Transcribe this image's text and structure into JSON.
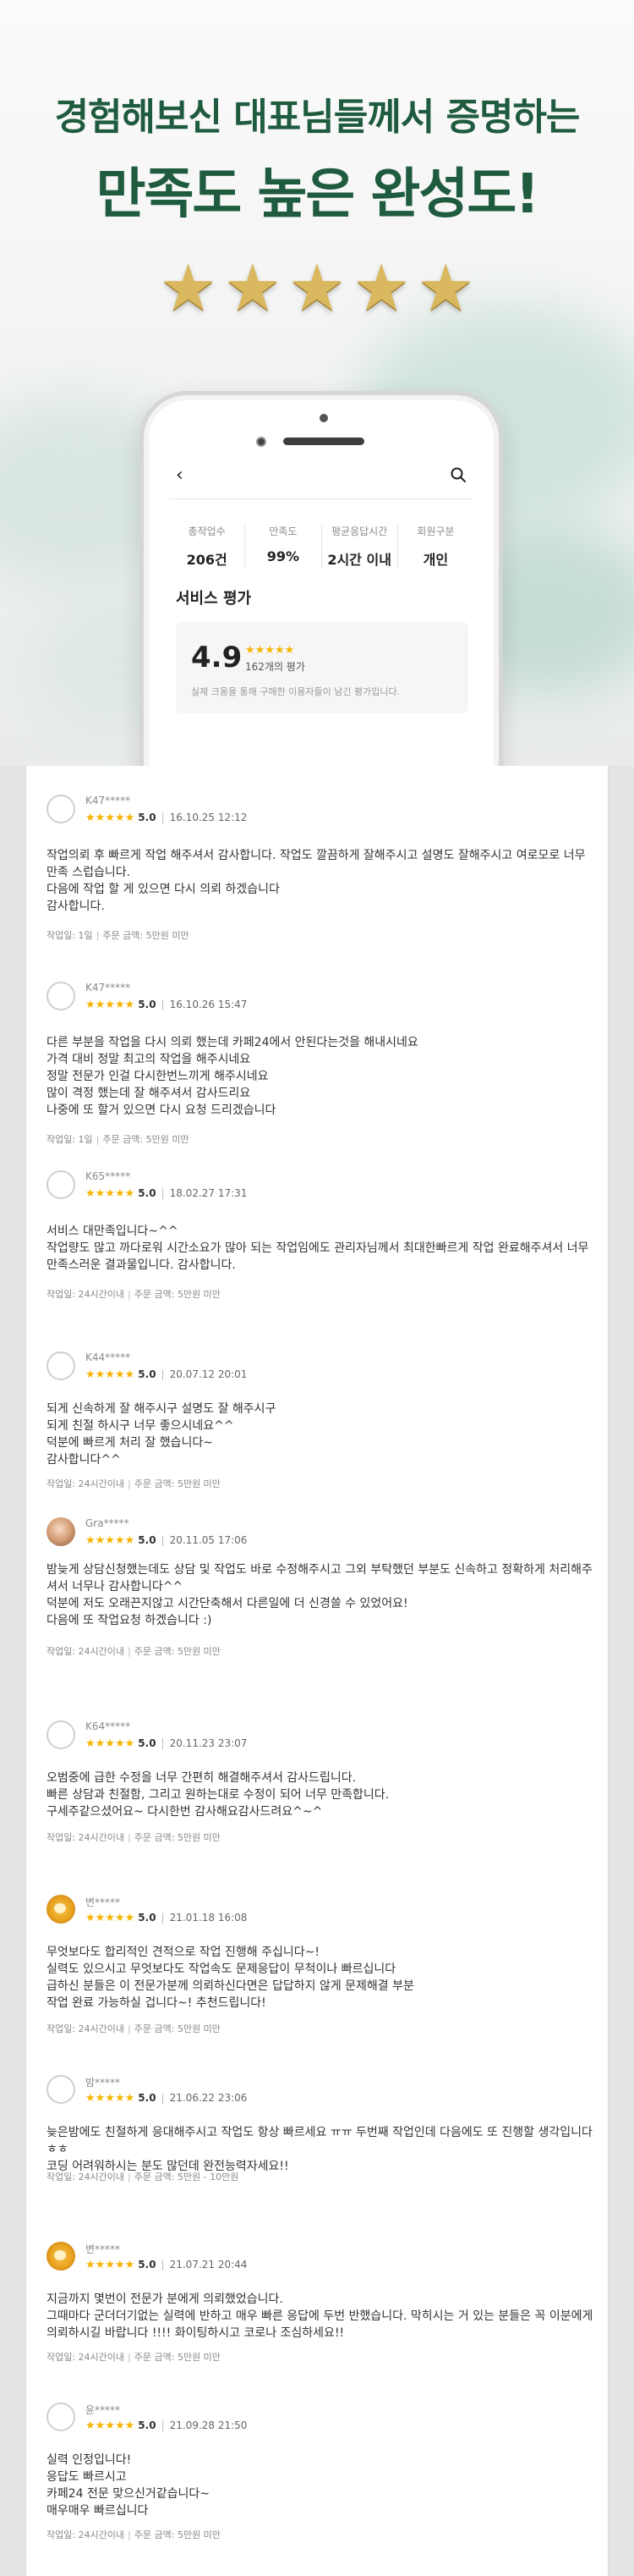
{
  "hero": {
    "line1": "경험해보신 대표님들께서 증명하는",
    "line2": "만족도 높은 완성도!",
    "star_glyph": "★",
    "star_count": 5,
    "star_color": "#d9b860"
  },
  "phone": {
    "stats": [
      {
        "label": "총작업수",
        "value": "206건"
      },
      {
        "label": "만족도",
        "value": "99%"
      },
      {
        "label": "평균응답시간",
        "value": "2시간 이내"
      },
      {
        "label": "회원구분",
        "value": "개인"
      }
    ],
    "section_title": "서비스 평가",
    "rating": "4.9",
    "rating_stars": "★★★★★",
    "rating_count": "162개의 평가",
    "rating_note": "실제 크몽을 통해 구매한 이용자들이 남긴 평가입니다."
  },
  "reviews": [
    {
      "name": "K47*****",
      "avatar": "blank",
      "stars": "★★★★★",
      "score": "5.0",
      "date": "16.10.25 12:12",
      "body": "작업의뢰 후 빠르게 작업 해주셔서 감사합니다. 작업도 깔끔하게 잘해주시고 설명도 잘해주시고 여로모로 너무 만족 스럽습니다.\n다음에 작업 할 게 있으면 다시 의뢰 하겠습니다\n감사합니다.",
      "meta_period": "작업일: 1일",
      "meta_price": "주문 금액: 5만원 미만"
    },
    {
      "name": "K47*****",
      "avatar": "blank",
      "stars": "★★★★★",
      "score": "5.0",
      "date": "16.10.26 15:47",
      "body": "다른 부분을 작업을 다시 의뢰 했는데 카페24에서 안된다는것을 해내시네요\n가격 대비 정말 최고의 작업을 해주시네요\n정말 전문가 인걸 다시한번느끼게 해주시네요\n많이 격정 했는데 잘 해주셔서 감사드리요\n나중에 또 할거 있으면 다시 요청 드리겠습니다",
      "meta_period": "작업일: 1일",
      "meta_price": "주문 금액: 5만원 미만"
    },
    {
      "name": "K65*****",
      "avatar": "blank",
      "stars": "★★★★★",
      "score": "5.0",
      "date": "18.02.27 17:31",
      "body": "서비스 대만족입니다~^^\n작업량도 많고 까다로워 시간소요가 많아 되는 작업임에도 관리자님께서 최대한빠르게 작업 완료해주셔서 너무 만족스러운 결과물입니다. 감사합니다.",
      "meta_period": "작업일: 24시간이내",
      "meta_price": "주문 금액: 5만원 미만"
    },
    {
      "name": "K44*****",
      "avatar": "blank",
      "stars": "★★★★★",
      "score": "5.0",
      "date": "20.07.12 20:01",
      "body": "되게 신속하게 잘 해주시구 설명도 잘 해주시구\n되게 친절 하시구 너무 좋으시네요^^\n덕분에 빠르게 처리 잘 했습니다~\n감사합니다^^",
      "meta_period": "작업일: 24시간이내",
      "meta_price": "주문 금액: 5만원 미만"
    },
    {
      "name": "Gra*****",
      "avatar": "photo",
      "stars": "★★★★★",
      "score": "5.0",
      "date": "20.11.05 17:06",
      "body": "밤늦게 상담신청했는데도 상담 및 작업도 바로 수정해주시고 그외 부탁했던 부분도 신속하고 정확하게 처리해주셔서 너무나 감사합니다^^\n덕분에 저도 오래끈지않고 시간단축해서 다른일에 더 신경쓸 수 있었어요!\n다음에 또 작업요청 하겠습니다 :)",
      "meta_period": "작업일: 24시간이내",
      "meta_price": "주문 금액: 5만원 미만"
    },
    {
      "name": "K64*****",
      "avatar": "blank",
      "stars": "★★★★★",
      "score": "5.0",
      "date": "20.11.23 23:07",
      "body": "오범중에 급한 수정을 너무 간편히 해결해주셔서 감사드립니다.\n빠른 상담과 친절함, 그리고 원하는대로 수정이 되어 너무 만족합니다.\n구세주같으셨어요~ 다시한번 감사해요감사드려요^~^",
      "meta_period": "작업일: 24시간이내",
      "meta_price": "주문 금액: 5만원 미만"
    },
    {
      "name": "변*****",
      "avatar": "lion",
      "stars": "★★★★★",
      "score": "5.0",
      "date": "21.01.18 16:08",
      "body": "무엇보다도 합리적인 견적으로 작업 진행해 주십니다~!\n실력도 있으시고 무엇보다도 작업속도 문제응답이 무척이나 빠르십니다\n급하신 분들은 이 전문가분께 의뢰하신다면은 답답하지 않게 문제해결 부분\n작업 완료 가능하실 겁니다~! 추천드립니다!",
      "meta_period": "작업일: 24시간이내",
      "meta_price": "주문 금액: 5만원 미만"
    },
    {
      "name": "밤*****",
      "avatar": "blank",
      "stars": "★★★★★",
      "score": "5.0",
      "date": "21.06.22 23:06",
      "body": "늦은밤에도 친절하게 응대해주시고 작업도 항상 빠르세요 ㅠㅠ 두번째 작업인데 다음에도 또 진행할 생각입니다 ㅎㅎ\n코딩 어려워하시는 분도 많던데 완전능력자세요!!",
      "meta_period": "작업일: 24시간이내",
      "meta_price": "주문 금액: 5만원 - 10만원"
    },
    {
      "name": "변*****",
      "avatar": "lion",
      "stars": "★★★★★",
      "score": "5.0",
      "date": "21.07.21 20:44",
      "body": "지금까지 몇번이 전문가 분에게 의뢰했었습니다.\n그때마다 군더더기없는 실력에 반하고 매우 빠른 응답에 두번 반했습니다. 막히시는 거 있는 분들은 꼭 이분에게 의뢰하시길 바랍니다 !!!! 화이팅하시고 코로나 조심하세요!!",
      "meta_period": "작업일: 24시간이내",
      "meta_price": "주문 금액: 5만원 미만"
    },
    {
      "name": "윤*****",
      "avatar": "blank",
      "stars": "★★★★★",
      "score": "5.0",
      "date": "21.09.28 21:50",
      "body": "실력 인정입니다!\n응답도 빠르시고\n카페24 전문 맞으신거같습니다~\n매우매우 빠르십니다",
      "meta_period": "작업일: 24시간이내",
      "meta_price": "주문 금액: 5만원 미만"
    }
  ]
}
